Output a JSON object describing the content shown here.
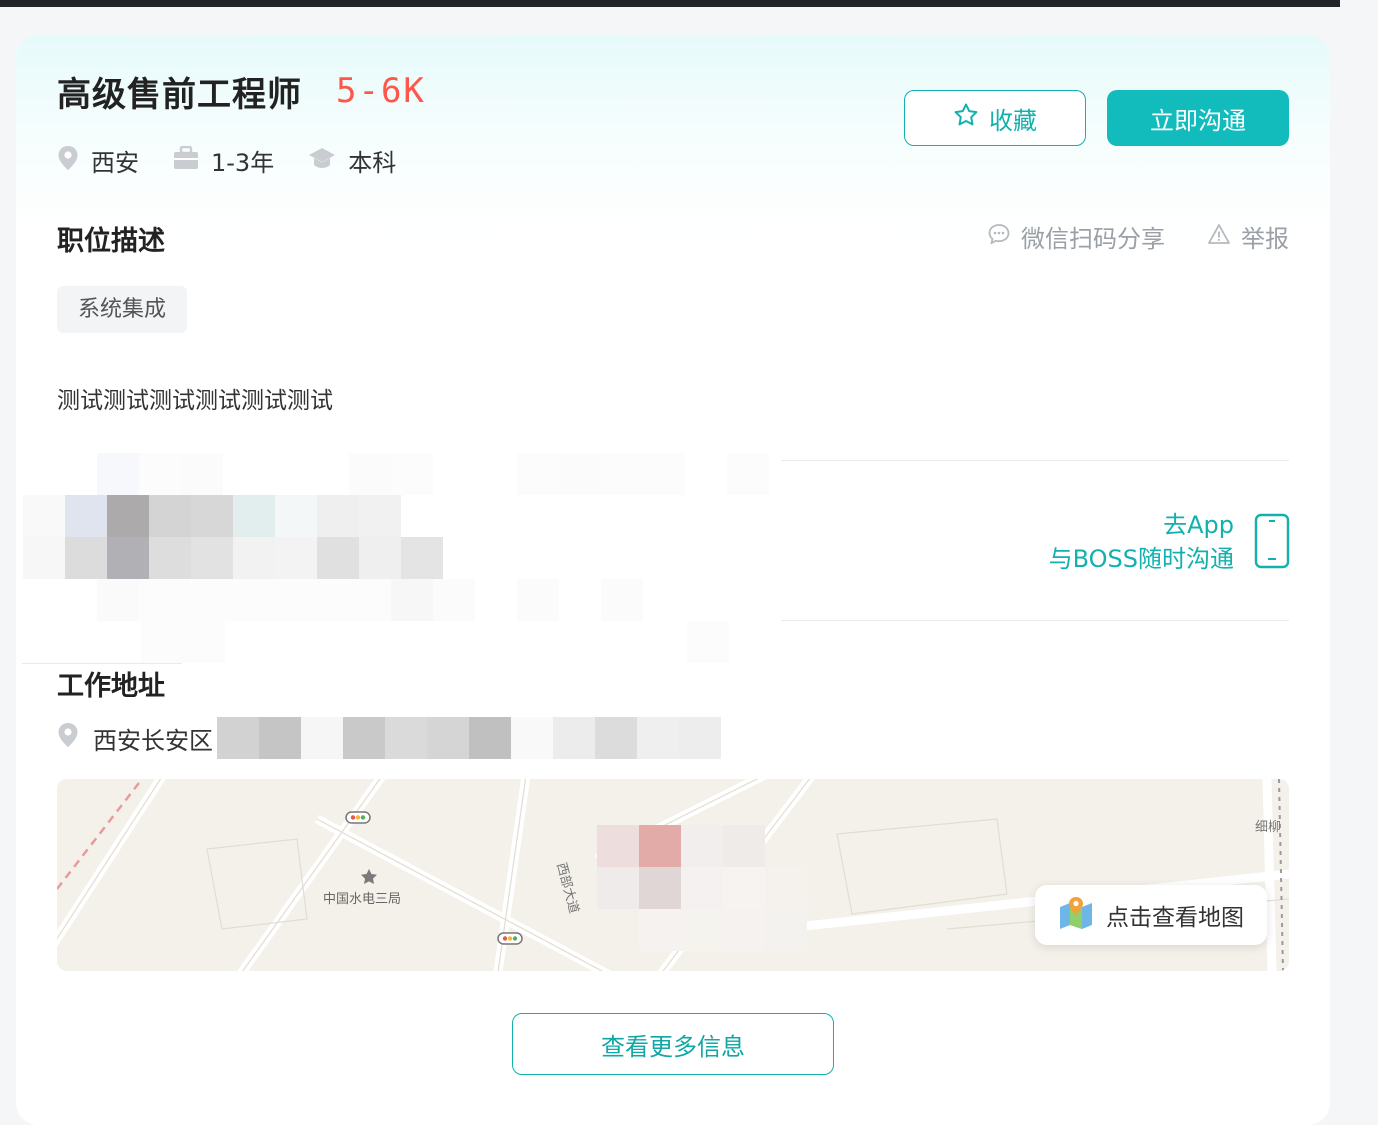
{
  "job": {
    "title": "高级售前工程师",
    "salary": "5-6K",
    "city": "西安",
    "experience": "1-3年",
    "degree": "本科"
  },
  "actions": {
    "favorite_label": "收藏",
    "chat_label": "立即沟通"
  },
  "description": {
    "section_title": "职位描述",
    "share_label": "微信扫码分享",
    "report_label": "举报",
    "tag": "系统集成",
    "text": "测试测试测试测试测试测试"
  },
  "app_promo": {
    "line1": "去App",
    "line2": "与BOSS随时沟通"
  },
  "address": {
    "section_title": "工作地址",
    "text": "西安长安区"
  },
  "map": {
    "button_label": "点击查看地图",
    "labels": [
      "中国水电三局",
      "细柳",
      "西部大道"
    ]
  },
  "more_info_label": "查看更多信息",
  "colors": {
    "accent": "#12b0ae",
    "salary": "#fe574a"
  }
}
